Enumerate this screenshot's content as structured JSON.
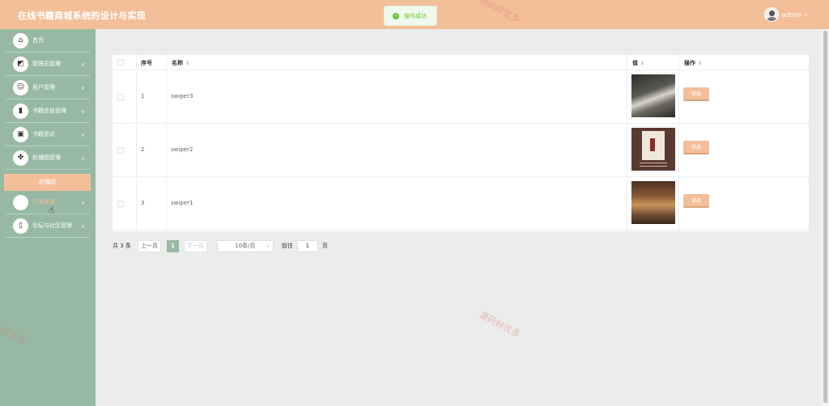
{
  "header": {
    "title": "在线书籍商城系统的设计与实现",
    "username": "admin",
    "toast": "操作成功"
  },
  "sidebar": {
    "items": [
      {
        "label": "首页",
        "icon": "home-icon"
      },
      {
        "label": "管理员管理",
        "icon": "crop-icon"
      },
      {
        "label": "用户管理",
        "icon": "user-icon"
      },
      {
        "label": "书籍信息管理",
        "icon": "book-icon"
      },
      {
        "label": "书籍资讯",
        "icon": "wallet-icon"
      },
      {
        "label": "轮播图管理",
        "icon": "grid-icon"
      },
      {
        "label": "订单管理",
        "icon": "order-icon"
      },
      {
        "label": "论坛与社区管理",
        "icon": "forum-icon"
      }
    ],
    "submenu": "轮播图"
  },
  "table": {
    "headers": {
      "index": "序号",
      "name": "名称",
      "value": "值",
      "action": "操作"
    },
    "rows": [
      {
        "index": "1",
        "name": "swiper3",
        "action": "修改"
      },
      {
        "index": "2",
        "name": "swiper2",
        "action": "修改"
      },
      {
        "index": "3",
        "name": "swiper1",
        "action": "修改"
      }
    ]
  },
  "pagination": {
    "total": "共 3 条",
    "prev": "上一页",
    "current": "1",
    "next": "下一页",
    "page_size": "10条/页",
    "goto_label": "前往",
    "goto_value": "1",
    "goto_suffix": "页"
  },
  "watermark": "源码好优多"
}
